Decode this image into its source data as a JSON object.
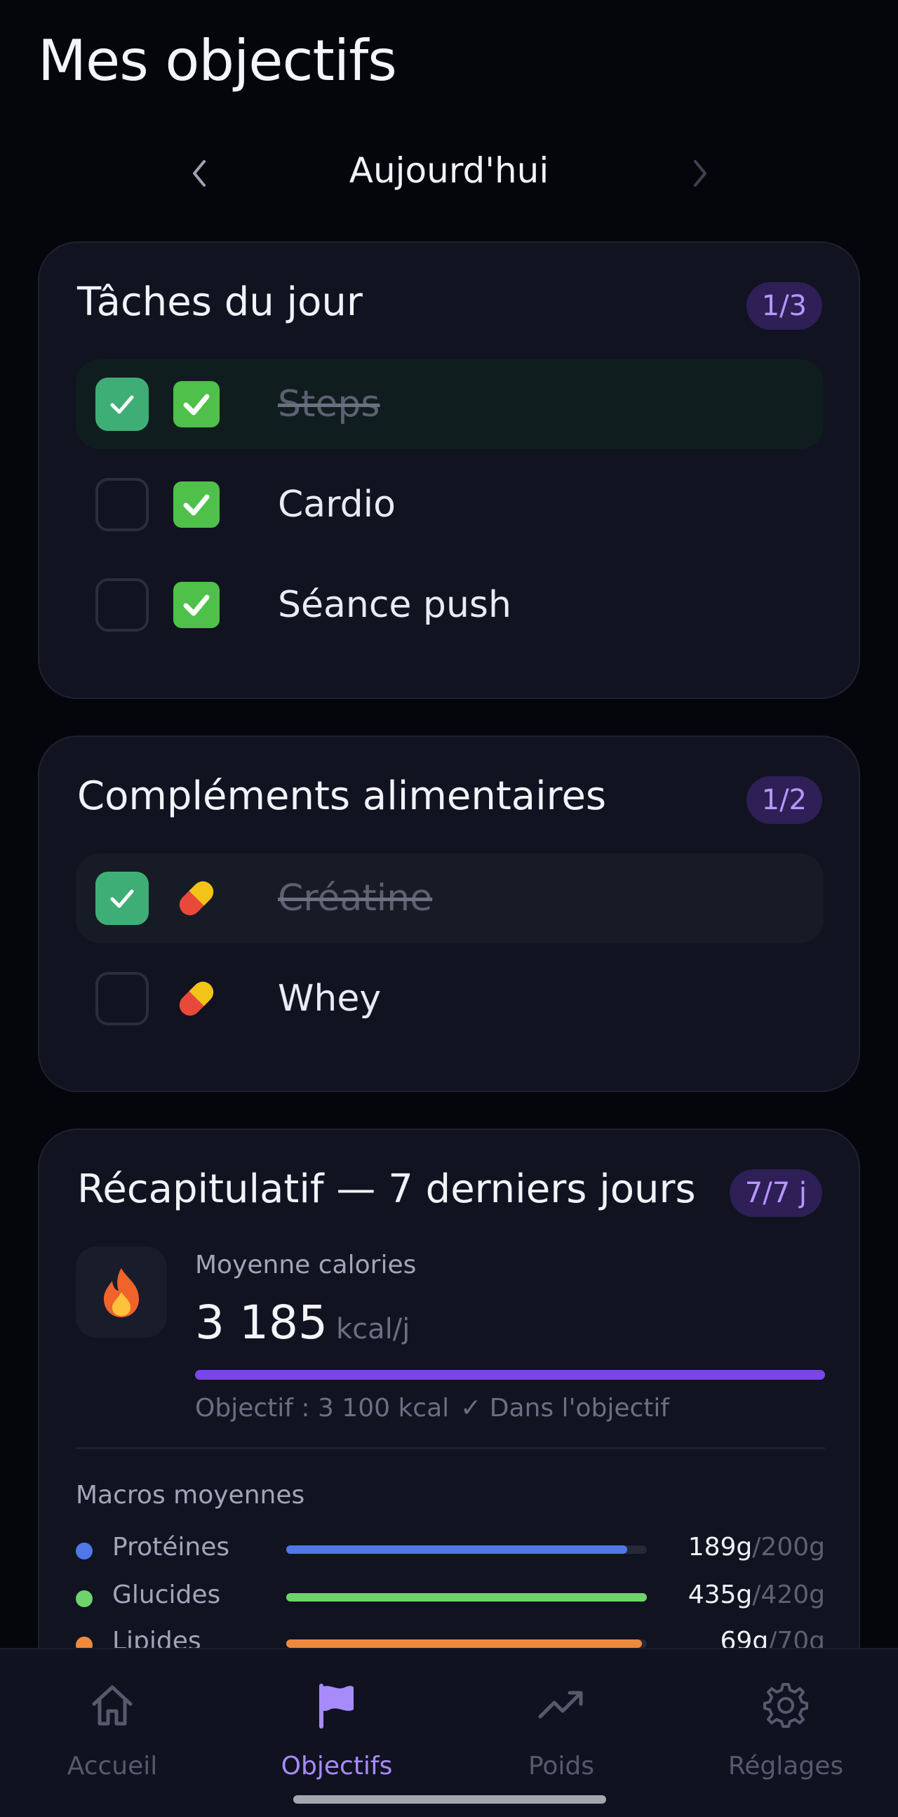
{
  "page": {
    "title": "Mes objectifs"
  },
  "date_nav": {
    "label": "Aujourd'hui",
    "prev_icon": "chevron-left-icon",
    "next_icon": "chevron-right-icon"
  },
  "tasks": {
    "title": "Tâches du jour",
    "badge": "1/3",
    "items": [
      {
        "emoji": "green-check-emoji",
        "label": "Steps",
        "done": true
      },
      {
        "emoji": "green-check-emoji",
        "label": "Cardio",
        "done": false
      },
      {
        "emoji": "green-check-emoji",
        "label": "Séance push",
        "done": false
      }
    ]
  },
  "supplements": {
    "title": "Compléments alimentaires",
    "badge": "1/2",
    "items": [
      {
        "emoji": "pill-emoji",
        "label": "Créatine",
        "done": true
      },
      {
        "emoji": "pill-emoji",
        "label": "Whey",
        "done": false
      }
    ]
  },
  "summary": {
    "title": "Récapitulatif — 7 derniers jours",
    "badge": "7/7 j",
    "icon": "fire-icon",
    "calories_label": "Moyenne calories",
    "calories_value": "3 185",
    "calories_unit": "kcal/j",
    "progress_fraction": 1.0,
    "goal_text": "Objectif : 3 100 kcal",
    "status_text": "✓ Dans l'objectif",
    "macros_title": "Macros moyennes",
    "macros": [
      {
        "name": "Protéines",
        "value": "189g",
        "goal": "/200g",
        "fraction": 0.945,
        "color": "#4f78e6"
      },
      {
        "name": "Glucides",
        "value": "435g",
        "goal": "/420g",
        "fraction": 1.0,
        "color": "#6ed36b"
      },
      {
        "name": "Lipides",
        "value": "69g",
        "goal": "/70g",
        "fraction": 0.986,
        "color": "#ef8a3c"
      }
    ]
  },
  "tabs": [
    {
      "label": "Accueil",
      "icon": "home-icon",
      "active": false
    },
    {
      "label": "Objectifs",
      "icon": "flag-icon",
      "active": true
    },
    {
      "label": "Poids",
      "icon": "trend-up-icon",
      "active": false
    },
    {
      "label": "Réglages",
      "icon": "gear-icon",
      "active": false
    }
  ],
  "colors": {
    "accent": "#7a46e6",
    "success": "#3fae76",
    "background": "#05060b"
  }
}
